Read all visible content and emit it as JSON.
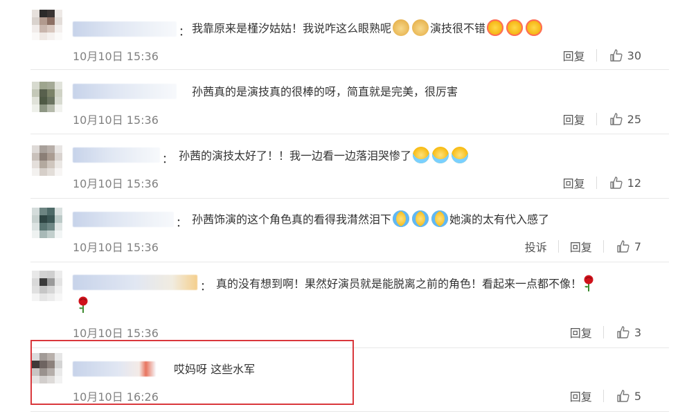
{
  "comments": [
    {
      "text": "我靠原来是槿汐姑姑！我说咋这么眼熟呢",
      "text2": "演技很不错",
      "time": "10月10日 15:36",
      "reply": "回复",
      "likes": "30"
    },
    {
      "text": "孙茜真的是演技真的很棒的呀，简直就是完美，很厉害",
      "time": "10月10日 15:36",
      "reply": "回复",
      "likes": "25"
    },
    {
      "text": "孙茜的演技太好了！！我一边看一边落泪哭惨了",
      "time": "10月10日 15:36",
      "reply": "回复",
      "likes": "12"
    },
    {
      "text": "孙茜饰演的这个角色真的看得我潸然泪下",
      "text2": "她演的太有代入感了",
      "time": "10月10日 15:36",
      "report": "投诉",
      "reply": "回复",
      "likes": "7"
    },
    {
      "text": "真的没有想到啊！果然好演员就是能脱离之前的角色！看起来一点都不像！",
      "time": "10月10日 15:36",
      "reply": "回复",
      "likes": "3"
    },
    {
      "text": "哎妈呀 这些水军",
      "time": "10月10日 16:26",
      "reply": "回复",
      "likes": "5"
    }
  ],
  "colors": {
    "highlight": "#d9373b",
    "time": "#808080"
  },
  "icons": {
    "like": "thumbs-up-icon",
    "rose": "rose-emoji",
    "emoji": "weibo-emoji"
  }
}
